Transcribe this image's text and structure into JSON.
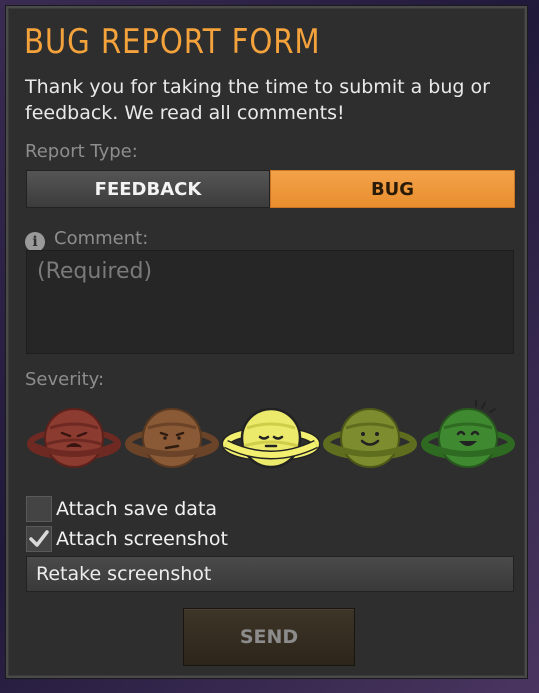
{
  "form": {
    "title": "BUG REPORT FORM",
    "description": "Thank you for taking the time to submit a bug or feedback. We read all comments!",
    "report_type_label": "Report Type:",
    "types": [
      "FEEDBACK",
      "BUG"
    ],
    "selected_type": "BUG",
    "comment_label": "Comment:",
    "comment_placeholder": "(Required)",
    "severity_label": "Severity:",
    "severity_options": [
      {
        "icon": "planet-angry-icon",
        "color": "#8c3b30"
      },
      {
        "icon": "planet-annoyed-icon",
        "color": "#8a5a36"
      },
      {
        "icon": "planet-neutral-icon",
        "color": "#e9e86a"
      },
      {
        "icon": "planet-happy-icon",
        "color": "#7d8c2e"
      },
      {
        "icon": "planet-delighted-icon",
        "color": "#3f8a30"
      }
    ],
    "selected_severity_index": 2,
    "attach_save_label": "Attach save data",
    "attach_save_checked": false,
    "attach_screenshot_label": "Attach screenshot",
    "attach_screenshot_checked": true,
    "retake_label": "Retake screenshot",
    "send_label": "SEND"
  },
  "colors": {
    "accent": "#f4a23c",
    "panel": "#2e2e2e",
    "bug_button": "#f09a3c"
  }
}
